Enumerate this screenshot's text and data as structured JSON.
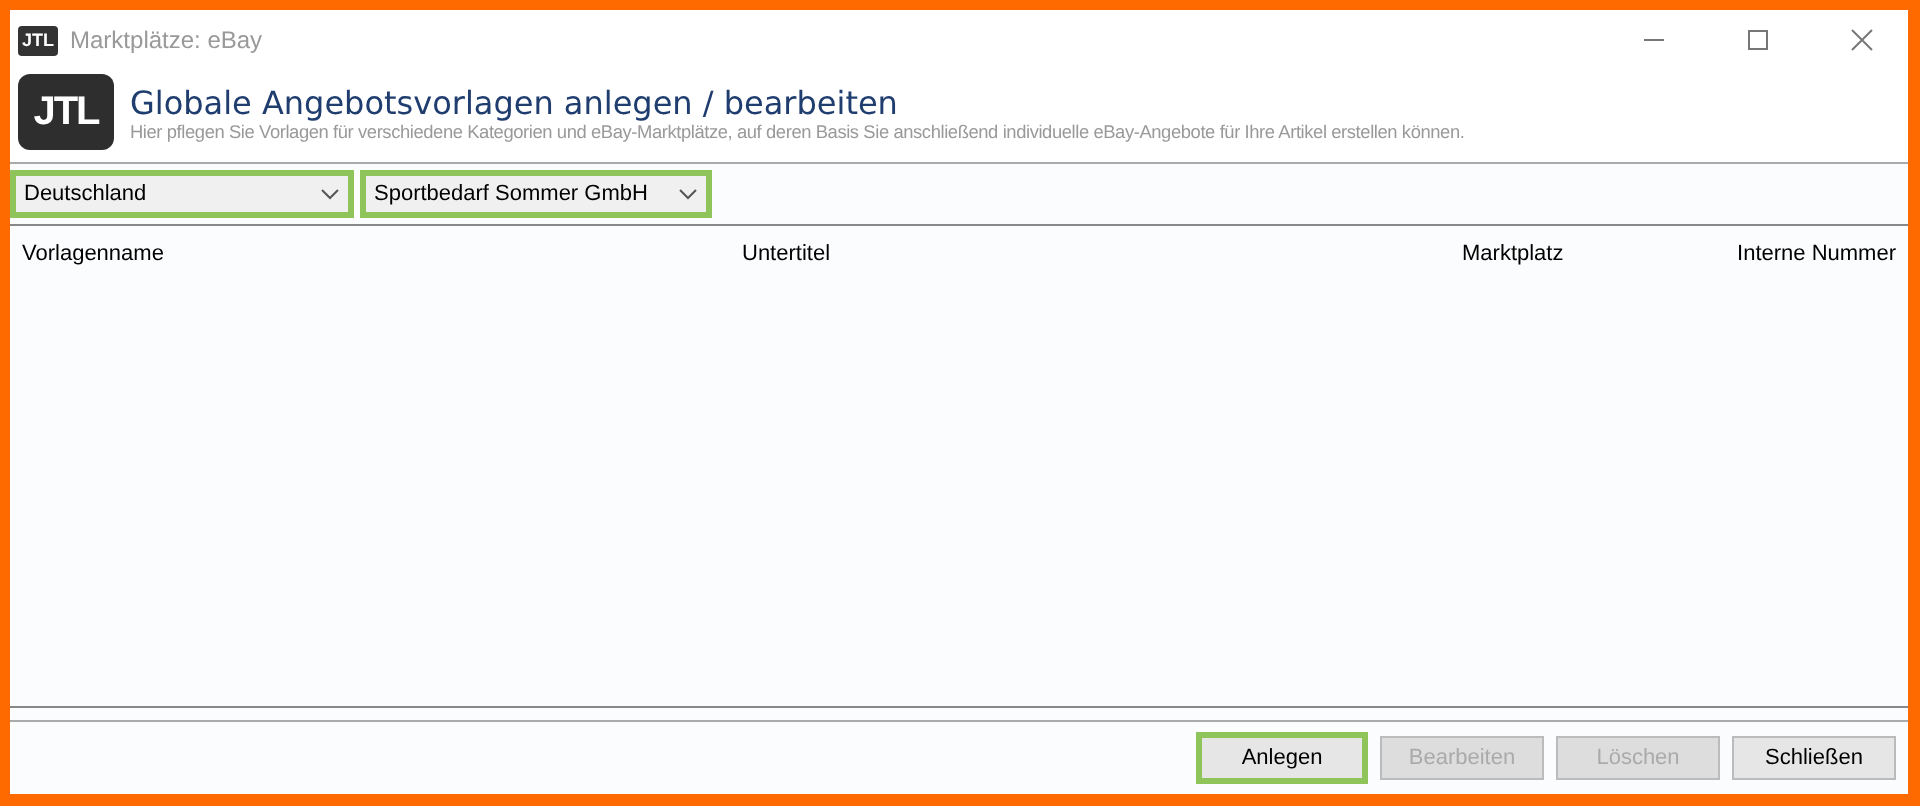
{
  "window": {
    "icon_text": "JTL",
    "title": "Marktplätze: eBay"
  },
  "header": {
    "logo": "JTL",
    "title": "Globale Angebotsvorlagen anlegen / bearbeiten",
    "subtitle": "Hier pflegen Sie Vorlagen für verschiedene Kategorien und eBay-Marktplätze, auf deren Basis Sie anschließend individuelle eBay-Angebote für Ihre Artikel erstellen können."
  },
  "filters": [
    {
      "value": "Deutschland",
      "highlighted": true
    },
    {
      "value": "Sportbedarf Sommer GmbH",
      "highlighted": true
    }
  ],
  "table": {
    "columns": [
      "Vorlagenname",
      "Untertitel",
      "Marktplatz",
      "Interne Nummer"
    ]
  },
  "buttons": [
    {
      "label": "Anlegen",
      "disabled": false,
      "highlighted": true
    },
    {
      "label": "Bearbeiten",
      "disabled": true,
      "highlighted": false
    },
    {
      "label": "Löschen",
      "disabled": true,
      "highlighted": false
    },
    {
      "label": "Schließen",
      "disabled": false,
      "highlighted": false
    }
  ]
}
